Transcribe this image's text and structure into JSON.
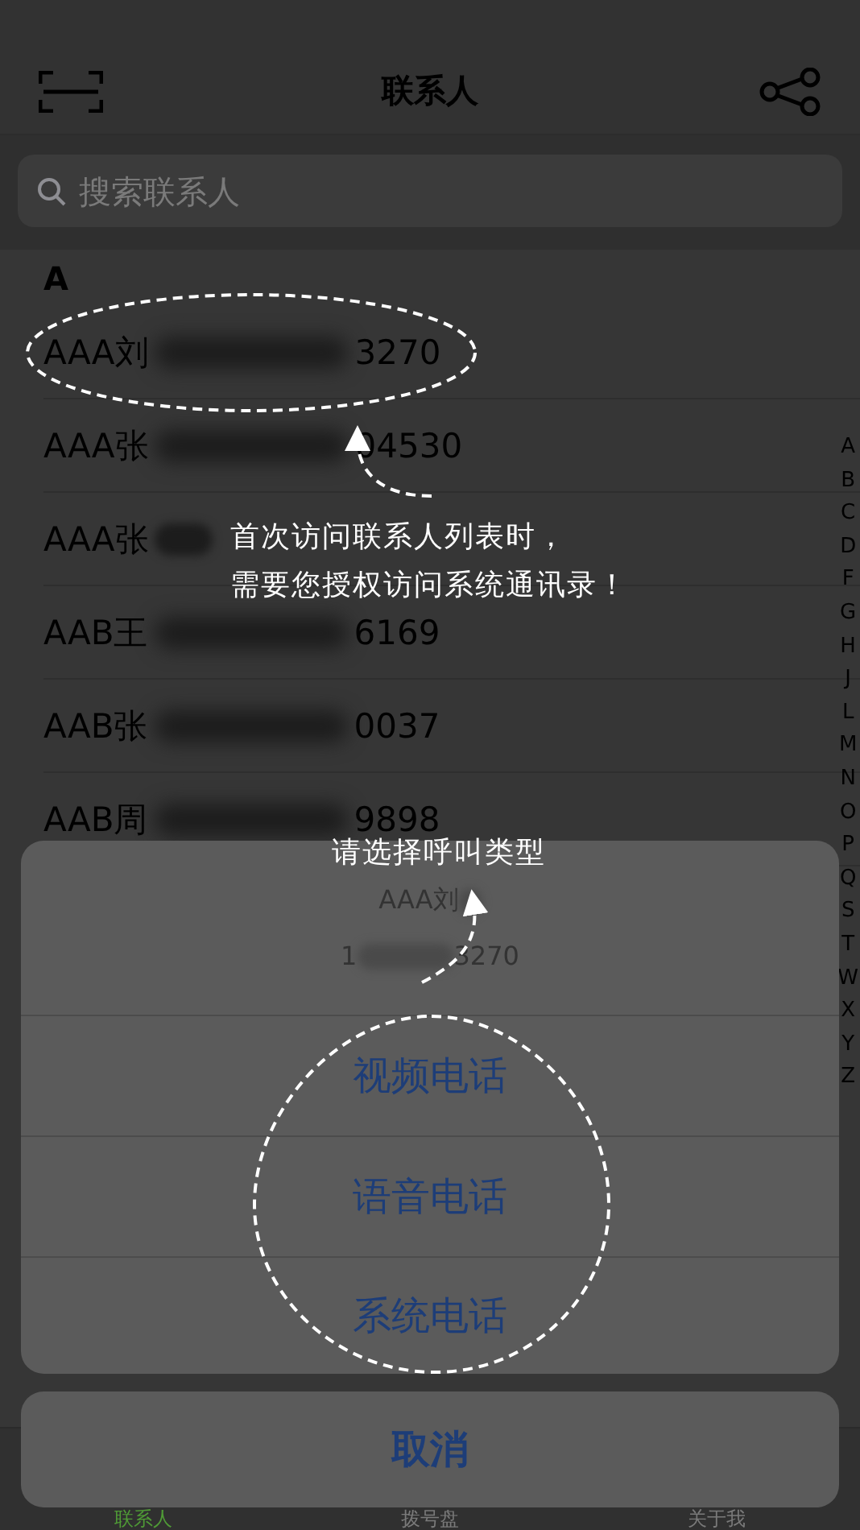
{
  "nav_bar": {
    "title": "联系人"
  },
  "search": {
    "placeholder": "搜索联系人"
  },
  "section_header": "A",
  "contacts": [
    {
      "name": "AAA刘",
      "number_end": "3270"
    },
    {
      "name": "AAA张",
      "number_end": "04530"
    },
    {
      "name": "AAA张"
    },
    {
      "name": "AAB王",
      "number_end": "6169"
    },
    {
      "name": "AAB张",
      "number_end": "0037"
    },
    {
      "name": "AAB周",
      "number_end": "9898"
    }
  ],
  "index_letters": [
    "A",
    "B",
    "C",
    "D",
    "F",
    "G",
    "H",
    "J",
    "L",
    "M",
    "N",
    "O",
    "P",
    "Q",
    "S",
    "T",
    "W",
    "X",
    "Y",
    "Z"
  ],
  "tab_bar": [
    {
      "label": "联系人",
      "selected": true
    },
    {
      "label": "拨号盘",
      "selected": false
    },
    {
      "label": "关于我",
      "selected": false
    }
  ],
  "action_sheet": {
    "contact_name": "AAA刘",
    "number_start": "1",
    "number_end": "3270",
    "options": [
      "视频电话",
      "语音电话",
      "系统电话"
    ],
    "cancel": "取消"
  },
  "annotations": {
    "permission_hint": [
      "首次访问联系人列表时，",
      "需要您授权访问系统通讯录！"
    ],
    "call_type_hint": "请选择呼叫类型"
  }
}
